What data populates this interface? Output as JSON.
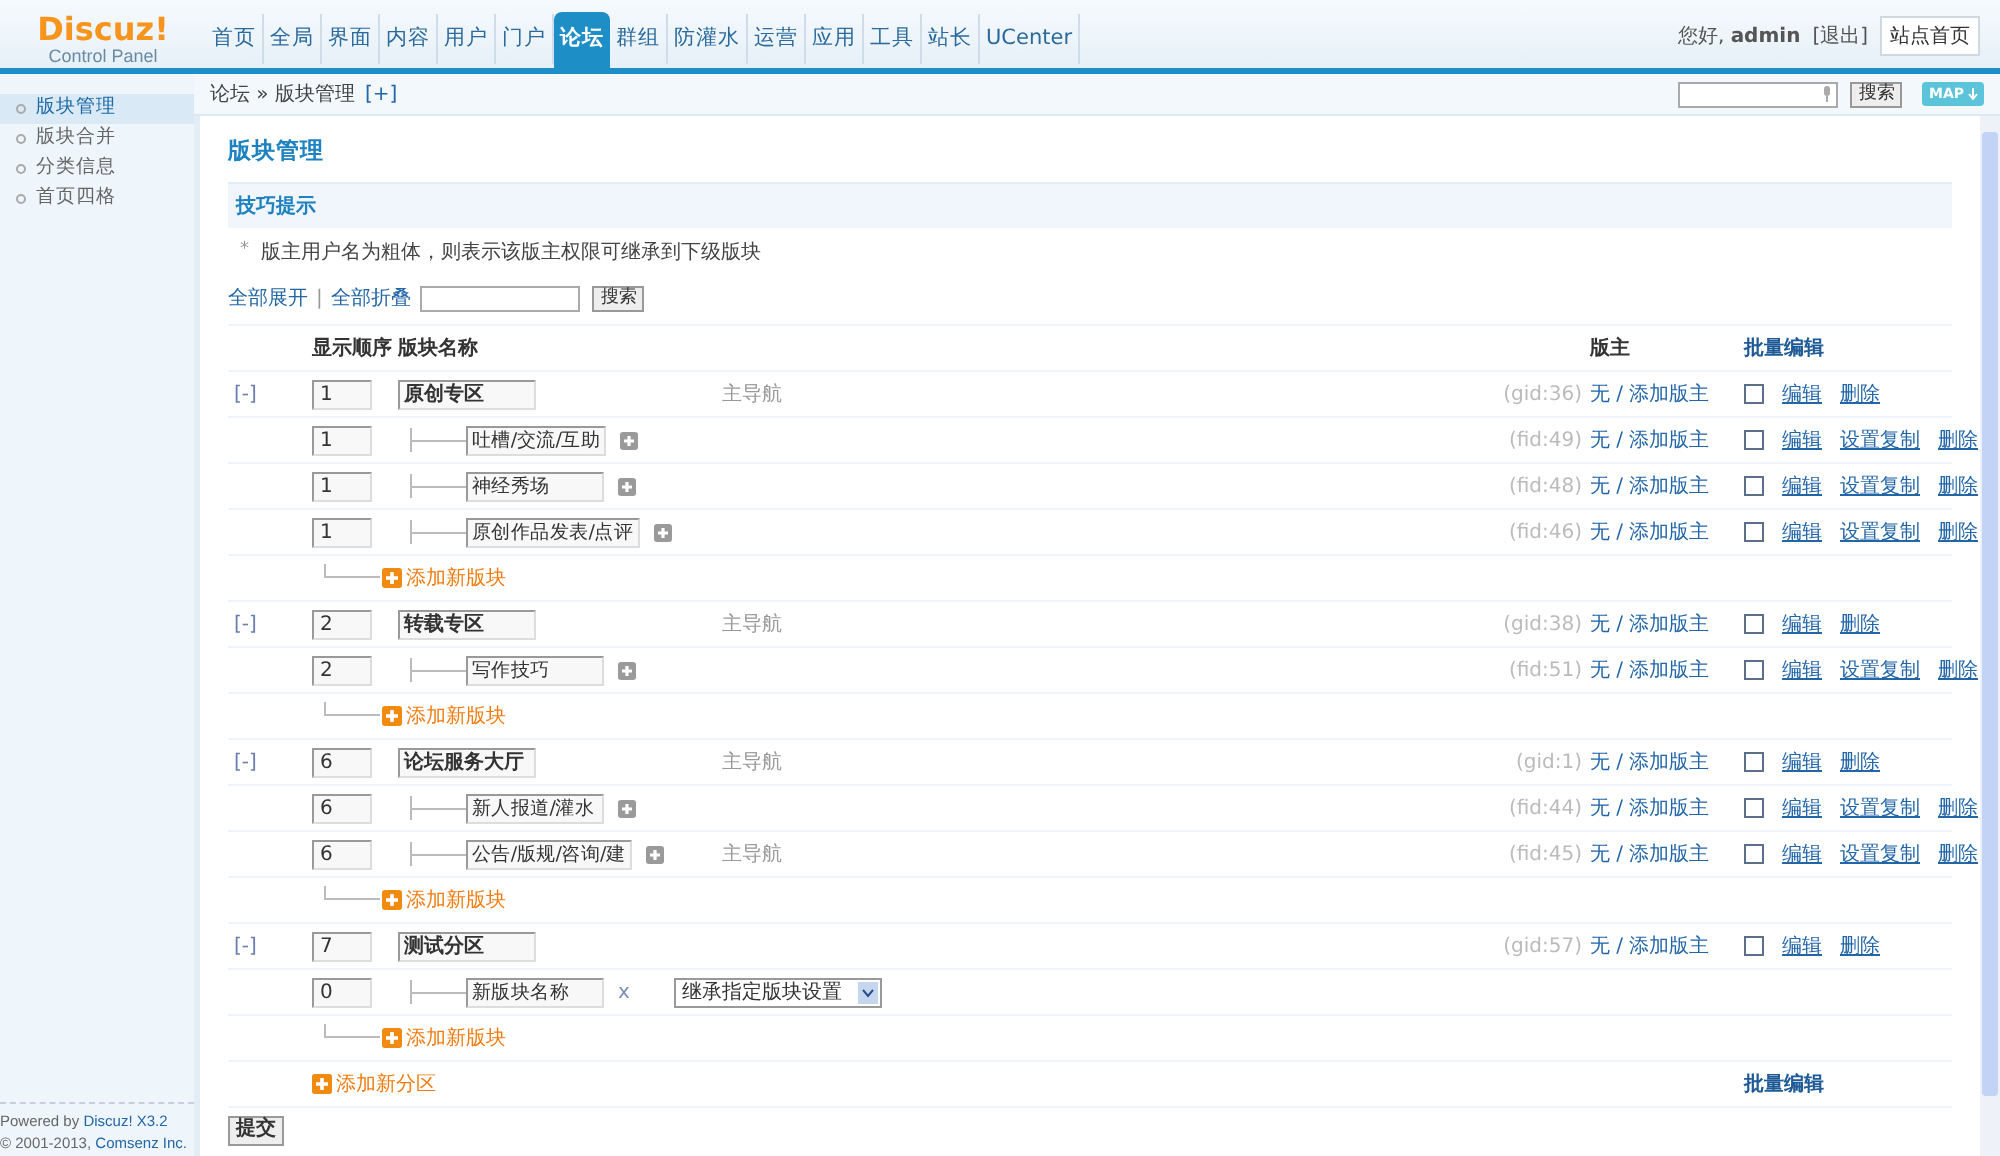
{
  "logo": {
    "name": "Discuz!",
    "subtitle": "Control Panel"
  },
  "nav_tabs": [
    {
      "label": "首页",
      "selected": false
    },
    {
      "label": "全局",
      "selected": false
    },
    {
      "label": "界面",
      "selected": false
    },
    {
      "label": "内容",
      "selected": false
    },
    {
      "label": "用户",
      "selected": false
    },
    {
      "label": "门户",
      "selected": false
    },
    {
      "label": "论坛",
      "selected": true
    },
    {
      "label": "群组",
      "selected": false
    },
    {
      "label": "防灌水",
      "selected": false
    },
    {
      "label": "运营",
      "selected": false
    },
    {
      "label": "应用",
      "selected": false
    },
    {
      "label": "工具",
      "selected": false
    },
    {
      "label": "站长",
      "selected": false
    },
    {
      "label": "UCenter",
      "selected": false
    }
  ],
  "user": {
    "greeting": "您好,",
    "name": "admin",
    "logout": "[退出]",
    "home_button": "站点首页"
  },
  "breadcrumb": {
    "path": "论坛 » 版块管理",
    "add": "[+]"
  },
  "header_search": {
    "button": "搜索",
    "map_label": "MAP"
  },
  "sidebar": {
    "items": [
      {
        "label": "版块管理",
        "selected": true
      },
      {
        "label": "版块合并",
        "selected": false
      },
      {
        "label": "分类信息",
        "selected": false
      },
      {
        "label": "首页四格",
        "selected": false
      }
    ]
  },
  "footer": [
    {
      "prefix": "Powered by ",
      "link": "Discuz! X3.2"
    },
    {
      "prefix": "© 2001-2013, ",
      "link": "Comsenz Inc."
    }
  ],
  "page_title": "版块管理",
  "tips": {
    "title": "技巧提示",
    "items": [
      {
        "marker": "*",
        "text": "版主用户名为粗体，则表示该版主权限可继承到下级版块"
      }
    ]
  },
  "toolbar": {
    "expand_all": "全部展开",
    "separator": "|",
    "collapse_all": "全部折叠",
    "search_button": "搜索"
  },
  "table": {
    "columns": [
      "显示顺序",
      "版块名称",
      "版主",
      "批量编辑"
    ],
    "categories": [
      {
        "toggle": "[-]",
        "order": "1",
        "name": "原创专区",
        "nav": "主导航",
        "id": "(gid:36)",
        "moderator": "无 / 添加版主",
        "checked": false,
        "actions": [
          "编辑",
          "删除"
        ],
        "add_forum": "添加新版块",
        "forums": [
          {
            "kind": "forum",
            "order": "1",
            "name": "吐槽/交流/互助",
            "id": "(fid:49)",
            "moderator": "无 / 添加版主",
            "checked": false,
            "actions": [
              "编辑",
              "设置复制",
              "删除"
            ]
          },
          {
            "kind": "forum",
            "order": "1",
            "name": "神经秀场",
            "id": "(fid:48)",
            "moderator": "无 / 添加版主",
            "checked": false,
            "actions": [
              "编辑",
              "设置复制",
              "删除"
            ]
          },
          {
            "kind": "forum",
            "order": "1",
            "name": "原创作品发表/点评",
            "id": "(fid:46)",
            "moderator": "无 / 添加版主",
            "checked": false,
            "actions": [
              "编辑",
              "设置复制",
              "删除"
            ]
          }
        ]
      },
      {
        "toggle": "[-]",
        "order": "2",
        "name": "转载专区",
        "nav": "主导航",
        "id": "(gid:38)",
        "moderator": "无 / 添加版主",
        "checked": false,
        "actions": [
          "编辑",
          "删除"
        ],
        "add_forum": "添加新版块",
        "forums": [
          {
            "kind": "forum",
            "order": "2",
            "name": "写作技巧",
            "id": "(fid:51)",
            "moderator": "无 / 添加版主",
            "checked": false,
            "actions": [
              "编辑",
              "设置复制",
              "删除"
            ]
          }
        ]
      },
      {
        "toggle": "[-]",
        "order": "6",
        "name": "论坛服务大厅",
        "nav": "主导航",
        "id": "(gid:1)",
        "moderator": "无 / 添加版主",
        "checked": false,
        "actions": [
          "编辑",
          "删除"
        ],
        "add_forum": "添加新版块",
        "forums": [
          {
            "kind": "forum",
            "order": "6",
            "name": "新人报道/灌水",
            "id": "(fid:44)",
            "moderator": "无 / 添加版主",
            "checked": false,
            "actions": [
              "编辑",
              "设置复制",
              "删除"
            ]
          },
          {
            "kind": "forum",
            "order": "6",
            "name": "公告/版规/咨询/建",
            "nav": "主导航",
            "id": "(fid:45)",
            "moderator": "无 / 添加版主",
            "checked": false,
            "actions": [
              "编辑",
              "设置复制",
              "删除"
            ]
          }
        ]
      },
      {
        "toggle": "[-]",
        "order": "7",
        "name": "测试分区",
        "id": "(gid:57)",
        "moderator": "无 / 添加版主",
        "checked": false,
        "actions": [
          "编辑",
          "删除"
        ],
        "add_forum": "添加新版块",
        "forums": [
          {
            "kind": "new",
            "order": "0",
            "name": "新版块名称",
            "remove": "x",
            "inherit": "继承指定版块设置"
          }
        ]
      }
    ],
    "add_category": "添加新分区",
    "footer_batch": "批量编辑"
  },
  "submit": "提交"
}
